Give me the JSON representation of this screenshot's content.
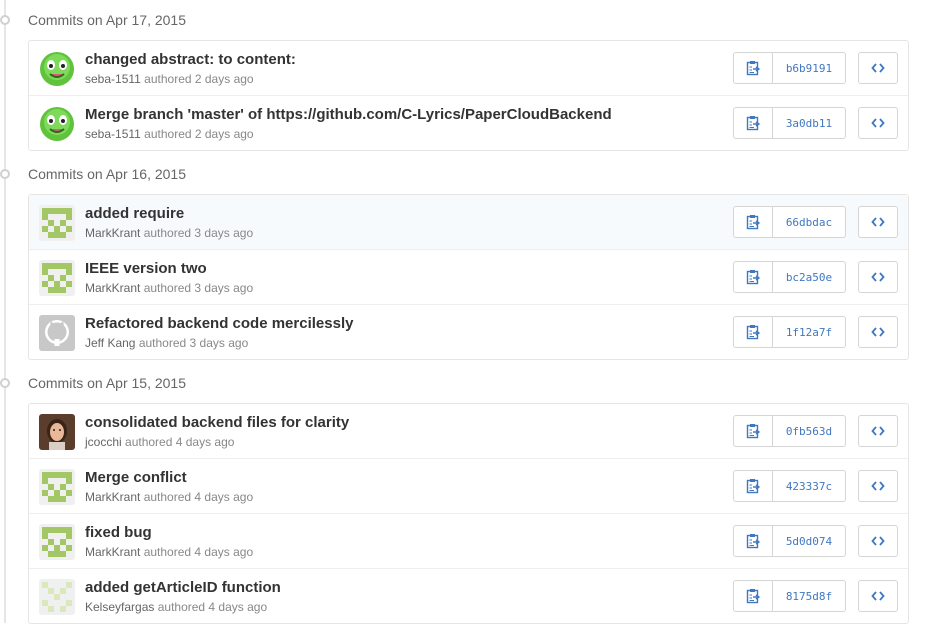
{
  "groups": [
    {
      "prefix": "Commits",
      "date": "on Apr 17, 2015",
      "commits": [
        {
          "message": "changed abstract: to content:",
          "author": "seba-1511",
          "time": "authored 2 days ago",
          "sha": "b6b9191",
          "avatar": "green-face"
        },
        {
          "message": "Merge branch 'master' of https://github.com/C-Lyrics/PaperCloudBackend",
          "author": "seba-1511",
          "time": "authored 2 days ago",
          "sha": "3a0db11",
          "avatar": "green-face"
        }
      ]
    },
    {
      "prefix": "Commits",
      "date": "on Apr 16, 2015",
      "commits": [
        {
          "message": "added require",
          "author": "MarkKrant",
          "time": "authored 3 days ago",
          "sha": "66dbdac",
          "avatar": "identicon-green"
        },
        {
          "message": "IEEE version two",
          "author": "MarkKrant",
          "time": "authored 3 days ago",
          "sha": "bc2a50e",
          "avatar": "identicon-green"
        },
        {
          "message": "Refactored backend code mercilessly",
          "author": "Jeff Kang",
          "time": "authored 3 days ago",
          "sha": "1f12a7f",
          "avatar": "octocat-gray"
        }
      ]
    },
    {
      "prefix": "Commits",
      "date": "on Apr 15, 2015",
      "commits": [
        {
          "message": "consolidated backend files for clarity",
          "author": "jcocchi",
          "time": "authored 4 days ago",
          "sha": "0fb563d",
          "avatar": "photo"
        },
        {
          "message": "Merge conflict",
          "author": "MarkKrant",
          "time": "authored 4 days ago",
          "sha": "423337c",
          "avatar": "identicon-green"
        },
        {
          "message": "fixed bug",
          "author": "MarkKrant",
          "time": "authored 4 days ago",
          "sha": "5d0d074",
          "avatar": "identicon-green"
        },
        {
          "message": "added getArticleID function",
          "author": "Kelseyfargas",
          "time": "authored 4 days ago",
          "sha": "8175d8f",
          "avatar": "identicon-light"
        }
      ]
    }
  ],
  "icons": {
    "copy": "clipboard-icon",
    "browse": "code-icon",
    "timeline": "timeline-dot-icon"
  },
  "colors": {
    "sha_link": "#4078c0",
    "identicon_green": "#a4c766",
    "identicon_light": "#dbe8be",
    "highlight_row": "#f7fafc"
  }
}
